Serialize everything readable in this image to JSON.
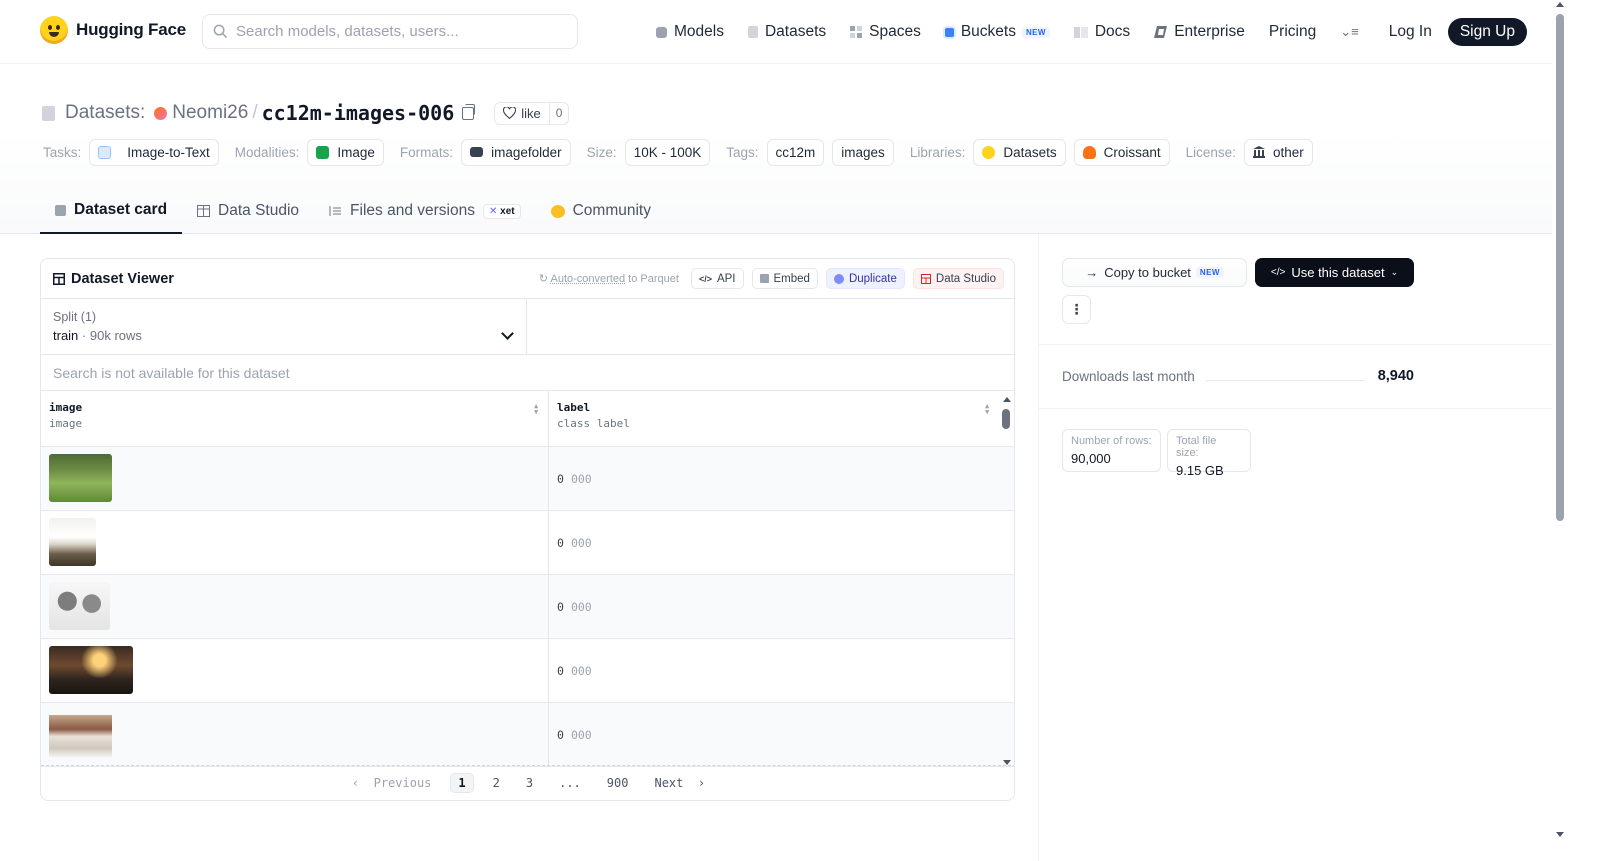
{
  "nav": {
    "brand": "Hugging Face",
    "search_placeholder": "Search models, datasets, users...",
    "links": [
      {
        "label": "Models",
        "icon": "cube-icon",
        "color": "#9ca3af"
      },
      {
        "label": "Datasets",
        "icon": "database-icon",
        "color": "#d1d5db"
      },
      {
        "label": "Spaces",
        "icon": "grid-icon",
        "color": "#cbd5e1"
      },
      {
        "label": "Buckets",
        "icon": "bucket-icon",
        "color": "#3b82f6",
        "badge": "NEW"
      },
      {
        "label": "Docs",
        "icon": "book-icon",
        "color": "#d1d5db"
      },
      {
        "label": "Enterprise",
        "icon": "enterprise-icon",
        "color": "#6b7280"
      },
      {
        "label": "Pricing"
      }
    ],
    "login": "Log In",
    "signup": "Sign Up"
  },
  "header": {
    "prefix": "Datasets:",
    "user": "Neomi26",
    "separator": "/",
    "name": "cc12m-images-006",
    "like_label": "like",
    "like_count": "0"
  },
  "tags": [
    {
      "label": "Tasks:",
      "items": [
        {
          "text": "Image-to-Text",
          "icon": "task-icon",
          "color": "#dbeafe"
        }
      ]
    },
    {
      "label": "Modalities:",
      "items": [
        {
          "text": "Image",
          "icon": "image-icon",
          "color": "#16a34a"
        }
      ]
    },
    {
      "label": "Formats:",
      "items": [
        {
          "text": "imagefolder",
          "icon": "folder-icon",
          "color": "#374151"
        }
      ]
    },
    {
      "label": "Size:",
      "items": [
        {
          "text": "10K - 100K"
        }
      ]
    },
    {
      "label": "Tags:",
      "items": [
        {
          "text": "cc12m"
        },
        {
          "text": "images"
        }
      ]
    },
    {
      "label": "Libraries:",
      "items": [
        {
          "text": "Datasets",
          "icon": "hf-icon",
          "color": "#ffd21e"
        },
        {
          "text": "Croissant",
          "icon": "croissant-icon",
          "color": "#f97316"
        }
      ]
    },
    {
      "label": "License:",
      "items": [
        {
          "text": "other",
          "icon": "bank-icon",
          "color": "#374151"
        }
      ]
    }
  ],
  "tabs": [
    {
      "label": "Dataset card",
      "active": true,
      "icon": "card-icon"
    },
    {
      "label": "Data Studio",
      "icon": "table-icon"
    },
    {
      "label": "Files and versions",
      "icon": "files-icon",
      "badge": "xet"
    },
    {
      "label": "Community",
      "icon": "community-icon"
    }
  ],
  "viewer": {
    "title": "Dataset Viewer",
    "autoconv_link": "Auto-converted",
    "autoconv_rest": " to Parquet",
    "actions": [
      "API",
      "Embed",
      "Duplicate",
      "Data Studio"
    ],
    "split_label": "Split (1)",
    "split_name": "train",
    "split_rows": "90k rows",
    "search_msg": "Search is not available for this dataset",
    "columns": [
      {
        "name": "image",
        "type": "image"
      },
      {
        "name": "label",
        "type": "class label"
      }
    ],
    "rows": [
      {
        "label_id": "0",
        "label_name": "000",
        "thumb_w": 63,
        "thumb": "grass"
      },
      {
        "label_id": "0",
        "label_name": "000",
        "thumb_w": 47,
        "thumb": "fashion"
      },
      {
        "label_id": "0",
        "label_name": "000",
        "thumb_w": 61,
        "thumb": "sketch"
      },
      {
        "label_id": "0",
        "label_name": "000",
        "thumb_w": 84,
        "thumb": "sunset"
      },
      {
        "label_id": "0",
        "label_name": "000",
        "thumb_w": 63,
        "thumb": "room"
      }
    ],
    "pager": {
      "prev": "Previous",
      "pages": [
        "1",
        "2",
        "3",
        "...",
        "900"
      ],
      "next": "Next"
    }
  },
  "sidebar": {
    "copy_bucket": "Copy to bucket",
    "copy_badge": "NEW",
    "use_dataset": "Use this dataset",
    "downloads_label": "Downloads last month",
    "downloads_value": "8,940",
    "rows_label": "Number of rows:",
    "rows_value": "90,000",
    "size_label": "Total file size:",
    "size_value": "9.15 GB"
  }
}
